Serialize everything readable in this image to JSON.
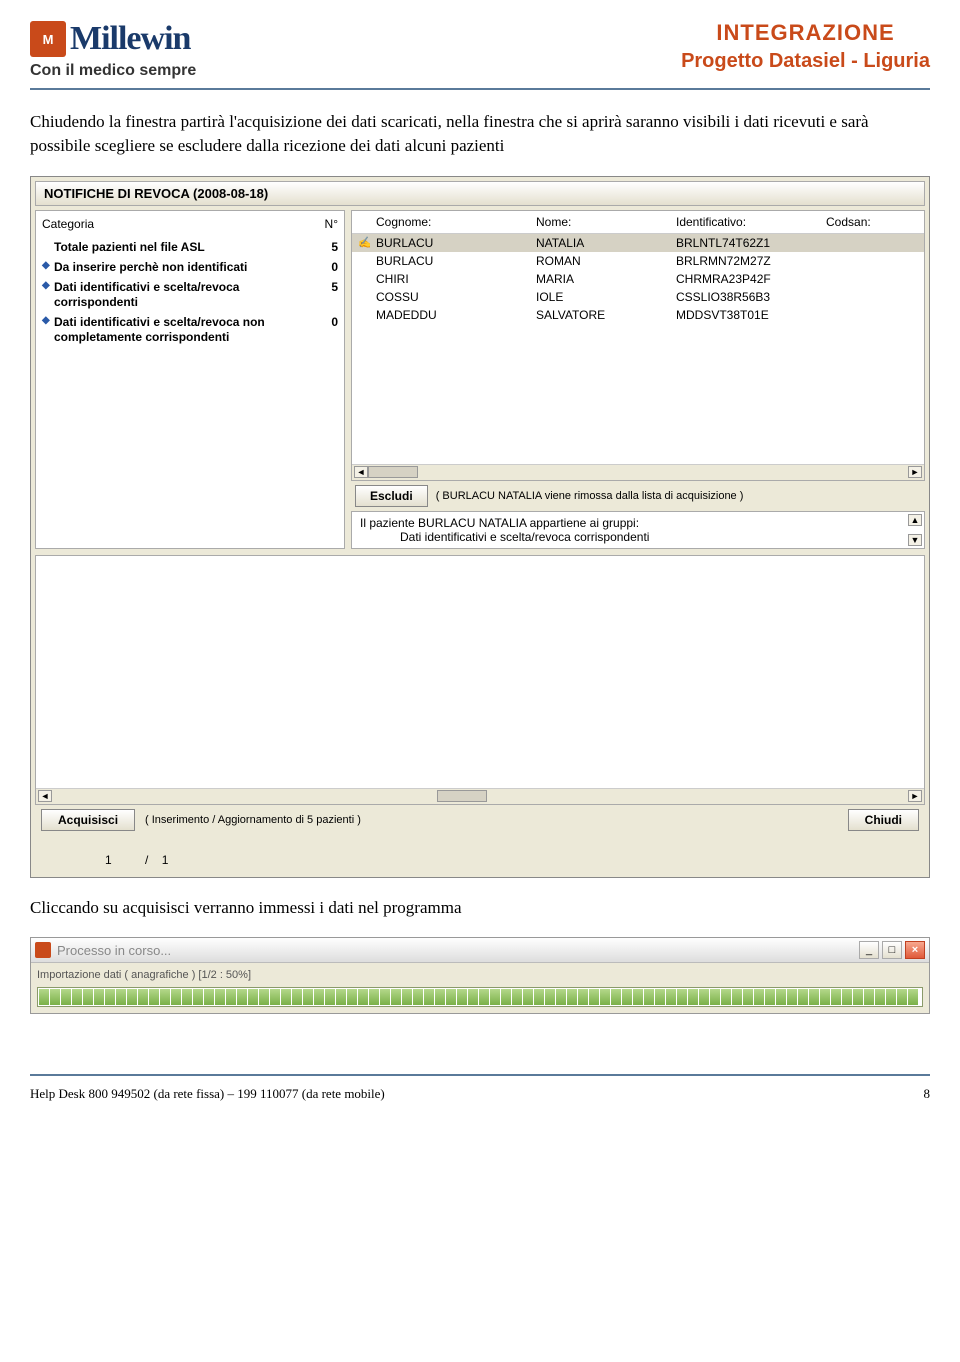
{
  "header": {
    "logo_text": "Millewin",
    "tagline": "Con il medico sempre",
    "title1": "INTEGRAZIONE",
    "title2": "Progetto Datasiel - Liguria"
  },
  "para1": "Chiudendo la finestra partirà l'acquisizione dei dati scaricati, nella finestra che si aprirà saranno visibili i dati ricevuti e sarà possibile scegliere se escludere dalla ricezione dei dati alcuni pazienti",
  "screenshot1": {
    "title": "NOTIFICHE DI REVOCA (2008-08-18)",
    "left_header_cat": "Categoria",
    "left_header_n": "N°",
    "categories": [
      {
        "bullet": "",
        "label": "Totale pazienti nel file ASL",
        "n": "5",
        "bold": true
      },
      {
        "bullet": "◆",
        "label": "Da inserire perchè non identificati",
        "n": "0",
        "bold": true
      },
      {
        "bullet": "◆",
        "label": "Dati identificativi e scelta/revoca corrispondenti",
        "n": "5",
        "bold": true
      },
      {
        "bullet": "◆",
        "label": "Dati identificativi e scelta/revoca non completamente corrispondenti",
        "n": "0",
        "bold": true
      }
    ],
    "right_headers": {
      "cognome": "Cognome:",
      "nome": "Nome:",
      "id": "Identificativo:",
      "codsan": "Codsan:"
    },
    "patients": [
      {
        "sel": true,
        "ico": "✍",
        "cognome": "BURLACU",
        "nome": "NATALIA",
        "id": "BRLNTL74T62Z1"
      },
      {
        "sel": false,
        "ico": "",
        "cognome": "BURLACU",
        "nome": "ROMAN",
        "id": "BRLRMN72M27Z"
      },
      {
        "sel": false,
        "ico": "",
        "cognome": "CHIRI",
        "nome": "MARIA",
        "id": "CHRMRA23P42F"
      },
      {
        "sel": false,
        "ico": "",
        "cognome": "COSSU",
        "nome": "IOLE",
        "id": "CSSLIO38R56B3"
      },
      {
        "sel": false,
        "ico": "",
        "cognome": "MADEDDU",
        "nome": "SALVATORE",
        "id": "MDDSVT38T01E"
      }
    ],
    "escludi_label": "Escludi",
    "escludi_note": "( BURLACU NATALIA viene rimossa dalla lista di acquisizione )",
    "msg_line1": "Il paziente BURLACU NATALIA appartiene ai gruppi:",
    "msg_line2": "Dati identificativi e scelta/revoca corrispondenti",
    "acquisisci_label": "Acquisisci",
    "acquisisci_note": "( Inserimento / Aggiornamento di 5 pazienti )",
    "chiudi_label": "Chiudi",
    "page_cur": "1",
    "page_sep": "/",
    "page_tot": "1"
  },
  "para2": "Cliccando su acquisisci verranno immessi i dati nel programma",
  "progress": {
    "title": "Processo in corso...",
    "label": "Importazione dati ( anagrafiche ) [1/2 : 50%]",
    "min_icon": "_",
    "max_icon": "□",
    "close_icon": "×"
  },
  "footer": {
    "left": "Help Desk 800 949502 (da rete fissa) – 199 110077 (da rete mobile)",
    "page": "8"
  }
}
